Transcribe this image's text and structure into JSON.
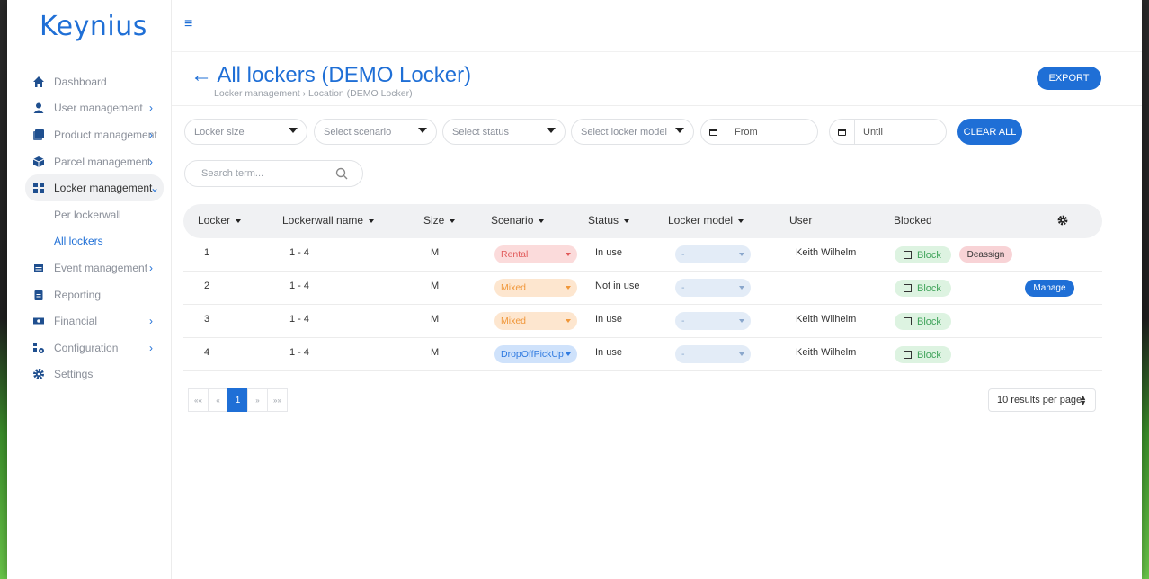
{
  "app": {
    "logo": "Keynius"
  },
  "sidebar": {
    "items": [
      {
        "label": "Dashboard",
        "icon": "home-icon",
        "chevron": false
      },
      {
        "label": "User management",
        "icon": "user-icon",
        "chevron": true
      },
      {
        "label": "Product management",
        "icon": "product-icon",
        "chevron": true
      },
      {
        "label": "Parcel management",
        "icon": "box-icon",
        "chevron": true
      },
      {
        "label": "Locker management",
        "icon": "grid-icon",
        "chevron": true,
        "expanded": true
      }
    ],
    "subitems": [
      {
        "label": "Per lockerwall"
      },
      {
        "label": "All lockers",
        "current": true
      }
    ],
    "items_after": [
      {
        "label": "Event management",
        "icon": "calendar-icon",
        "chevron": true
      },
      {
        "label": "Reporting",
        "icon": "clipboard-icon",
        "chevron": false
      },
      {
        "label": "Financial",
        "icon": "money-icon",
        "chevron": true
      },
      {
        "label": "Configuration",
        "icon": "config-icon",
        "chevron": true
      },
      {
        "label": "Settings",
        "icon": "gear-icon",
        "chevron": false
      }
    ]
  },
  "header": {
    "title": "← All lockers (DEMO Locker)",
    "breadcrumb": "Locker management  ›  Location (DEMO Locker)",
    "export_label": "EXPORT"
  },
  "filters": {
    "locker_size": "Locker size",
    "scenario": "Select scenario",
    "status": "Select status",
    "locker_model": "Select locker model",
    "from": "From",
    "until": "Until",
    "clear_all": "CLEAR ALL",
    "search_placeholder": "Search term..."
  },
  "table": {
    "columns": [
      "Locker",
      "Lockerwall name",
      "Size",
      "Scenario",
      "Status",
      "Locker model",
      "User",
      "Blocked"
    ],
    "rows": [
      {
        "locker": "1",
        "lockerwall": "1 - 4",
        "size": "M",
        "scenario": "Rental",
        "status": "In use",
        "model": "-",
        "user": "Keith Wilhelm",
        "block": "Block",
        "action": "Deassign"
      },
      {
        "locker": "2",
        "lockerwall": "1 - 4",
        "size": "M",
        "scenario": "Mixed",
        "status": "Not in use",
        "model": "-",
        "user": "",
        "block": "Block",
        "action": "Manage"
      },
      {
        "locker": "3",
        "lockerwall": "1 - 4",
        "size": "M",
        "scenario": "Mixed",
        "status": "In use",
        "model": "-",
        "user": "Keith Wilhelm",
        "block": "Block",
        "action": ""
      },
      {
        "locker": "4",
        "lockerwall": "1 - 4",
        "size": "M",
        "scenario": "DropOffPickUp",
        "status": "In use",
        "model": "-",
        "user": "Keith Wilhelm",
        "block": "Block",
        "action": ""
      }
    ]
  },
  "pagination": {
    "first": "««",
    "prev": "«",
    "current": "1",
    "next": "»",
    "last": "»»",
    "per_page": "10 results per page"
  },
  "colors": {
    "primary": "#1f6fd6",
    "brand_dot": "#3fb24b"
  }
}
